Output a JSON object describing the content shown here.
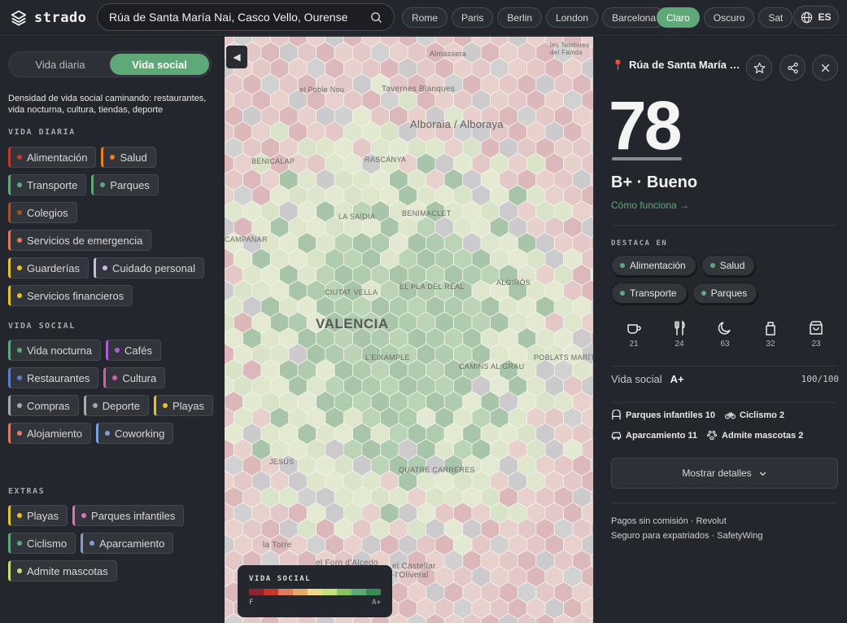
{
  "app": {
    "name": "strado"
  },
  "search": {
    "value": "Rúa de Santa María Nai, Casco Vello, Ourense"
  },
  "cities": [
    "Rome",
    "Paris",
    "Berlin",
    "London",
    "Barcelona"
  ],
  "themes": [
    {
      "label": "Claro",
      "active": true
    },
    {
      "label": "Oscuro",
      "active": false
    },
    {
      "label": "Sat",
      "active": false
    }
  ],
  "language": "ES",
  "sidebar": {
    "tabs": [
      {
        "label": "Vida diaria",
        "active": false
      },
      {
        "label": "Vida social",
        "active": true
      }
    ],
    "description": "Densidad de vida social caminando: restaurantes, vida nocturna, cultura, tiendas, deporte",
    "sections": [
      {
        "title": "VIDA DIARIA",
        "items": [
          {
            "label": "Alimentación",
            "color": "#c0392b"
          },
          {
            "label": "Salud",
            "color": "#e67e22"
          },
          {
            "label": "Transporte",
            "color": "#5fa878"
          },
          {
            "label": "Parques",
            "color": "#5fa878"
          },
          {
            "label": "Colegios",
            "color": "#a0522d"
          },
          {
            "label": "Servicios de emergencia",
            "color": "#e07a5f"
          },
          {
            "label": "Guarderías",
            "color": "#e6c229"
          },
          {
            "label": "Cuidado personal",
            "color": "#c9b7e6"
          },
          {
            "label": "Servicios financieros",
            "color": "#e6c229"
          }
        ]
      },
      {
        "title": "VIDA SOCIAL",
        "items": [
          {
            "label": "Vida nocturna",
            "color": "#5fa878"
          },
          {
            "label": "Cafés",
            "color": "#b05fd0"
          },
          {
            "label": "Restaurantes",
            "color": "#5b7fc4"
          },
          {
            "label": "Cultura",
            "color": "#d060a8"
          },
          {
            "label": "Compras",
            "color": "#aaaaaa"
          },
          {
            "label": "Deporte",
            "color": "#aaaaaa"
          },
          {
            "label": "Playas",
            "color": "#e6c229"
          },
          {
            "label": "Alojamiento",
            "color": "#e07a5f"
          },
          {
            "label": "Coworking",
            "color": "#7f9fd6"
          }
        ]
      },
      {
        "title": "EXTRAS",
        "items": [
          {
            "label": "Playas",
            "color": "#e6c229"
          },
          {
            "label": "Parques infantiles",
            "color": "#e070b8"
          },
          {
            "label": "Ciclismo",
            "color": "#5fa878"
          },
          {
            "label": "Aparcamiento",
            "color": "#7f9fd6"
          },
          {
            "label": "Admite mascotas",
            "color": "#c9e06a"
          }
        ]
      }
    ]
  },
  "map": {
    "labels": {
      "almassera": "Almàssera",
      "tendetes": "les Tendetes\ndel Famós",
      "poble_nou": "el Poble Nou",
      "tavernes": "Tavernes Blanques",
      "alboraia": "Alboraia / Alboraya",
      "benicalap": "BENICALAP",
      "rascanya": "RASCANYA",
      "saidia": "LA SAÏDIA",
      "benimaclet": "BENIMACLET",
      "campanar": "CAMPANAR",
      "ciutat_vella": "CIUTAT VELLA",
      "pla_del_real": "EL PLA DEL REAL",
      "algiros": "ALGIRÓS",
      "valencia": "VALENCIA",
      "eixample": "L'EIXAMPLE",
      "poblats_maritims": "POBLATS MARÍTIM",
      "camins": "CAMINS AL GRAU",
      "jesus": "JESÚS",
      "quatre_carreres": "QUATRE CARRERES",
      "la_torre": "la Torre",
      "forn": "el Forn d'Alcedo",
      "castellar": "el Castellar\n-l'Oliveral"
    },
    "legend": {
      "title": "VIDA SOCIAL",
      "low": "F",
      "high": "A+",
      "colors": [
        "#8e2431",
        "#c0392b",
        "#e07a5f",
        "#e8a868",
        "#efd88a",
        "#c8df7e",
        "#87c45f",
        "#5fa878",
        "#3a8a55"
      ]
    }
  },
  "panel": {
    "place": "Rúa de Santa María Nai, Casco Vello, Ourense",
    "score": "78",
    "grade": "B+ · Bueno",
    "how_link": "Cómo funciona →",
    "highlights_title": "DESTACA EN",
    "highlights": [
      "Alimentación",
      "Salud",
      "Transporte",
      "Parques"
    ],
    "icon_stats": [
      {
        "icon": "coffee-icon",
        "value": "21"
      },
      {
        "icon": "fork-knife-icon",
        "value": "24"
      },
      {
        "icon": "moon-icon",
        "value": "63"
      },
      {
        "icon": "bag-icon",
        "value": "32"
      },
      {
        "icon": "shopping-bag-icon",
        "value": "23"
      }
    ],
    "vida_social": {
      "label": "Vida social",
      "grade": "A+",
      "score": "100/100"
    },
    "amenities": [
      {
        "icon": "playground-icon",
        "label": "Parques infantiles 10"
      },
      {
        "icon": "bicycle-icon",
        "label": "Ciclismo 2"
      },
      {
        "icon": "car-icon",
        "label": "Aparcamiento 11"
      },
      {
        "icon": "paw-icon",
        "label": "Admite mascotas 2"
      }
    ],
    "details_button": "Mostrar detalles",
    "promo": [
      "Pagos sin comisión · Revolut",
      "Seguro para expatriados · SafetyWing"
    ]
  }
}
